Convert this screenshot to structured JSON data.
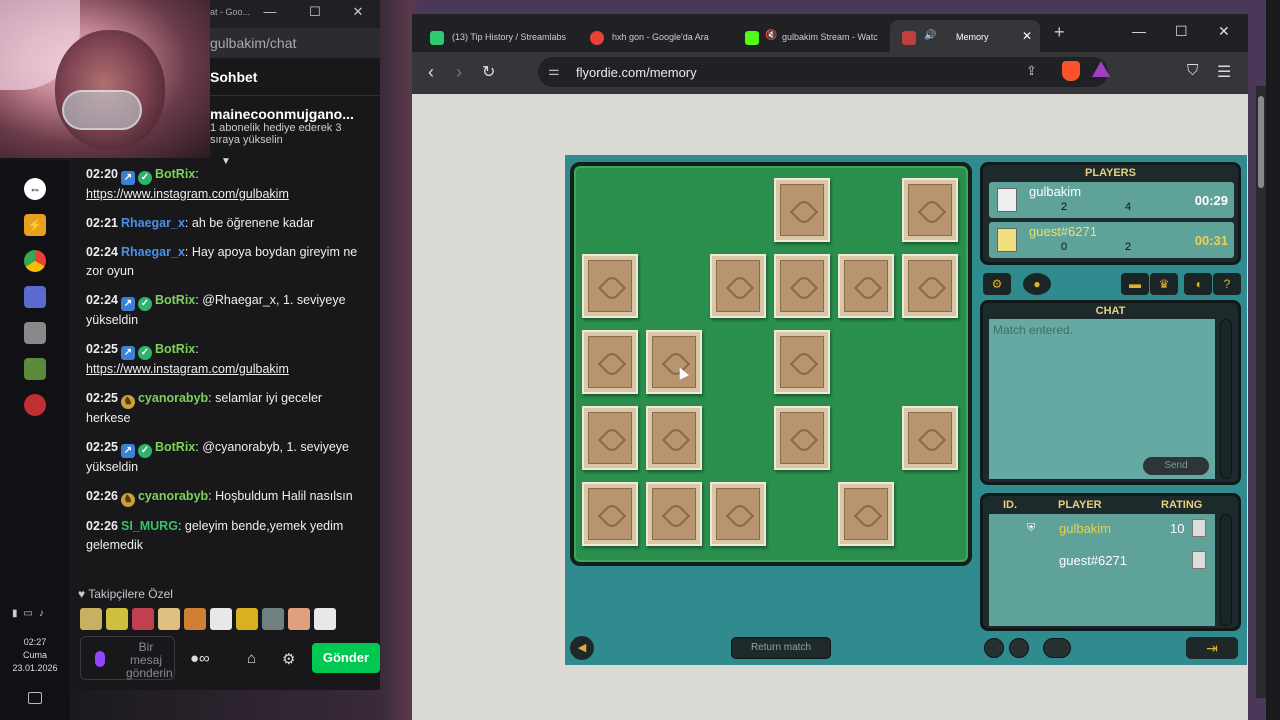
{
  "chat": {
    "window_title": "at - Goo...",
    "url": "gulbakim/chat",
    "header": "Sohbet",
    "pinned_user": "mainecoonmujgano...",
    "pinned_line1": "1 abonelik hediye ederek 3",
    "pinned_line2": "sıraya yükselin",
    "messages": [
      {
        "time": "02:20",
        "badges": [
          "pin",
          "chk"
        ],
        "name": "BotRix",
        "name_color": "#7bd35a",
        "text": "https://www.instagram.com/gulbakim",
        "link": true
      },
      {
        "time": "02:21",
        "badges": [],
        "name": "Rhaegar_x",
        "name_color": "#4f8fe6",
        "text": "ah be öğrenene kadar",
        "link": false
      },
      {
        "time": "02:24",
        "badges": [],
        "name": "Rhaegar_x",
        "name_color": "#4f8fe6",
        "text": "Hay apoya boydan gireyim ne zor oyun",
        "link": false
      },
      {
        "time": "02:24",
        "badges": [
          "pin",
          "chk"
        ],
        "name": "BotRix",
        "name_color": "#7bd35a",
        "text": "@Rhaegar_x, 1. seviyeye yükseldin",
        "link": false
      },
      {
        "time": "02:25",
        "badges": [
          "pin",
          "chk"
        ],
        "name": "BotRix",
        "name_color": "#7bd35a",
        "text": "https://www.instagram.com/gulbakim",
        "link": true
      },
      {
        "time": "02:25",
        "badges": [
          "cat"
        ],
        "name": "cyanorabyb",
        "name_color": "#7bd35a",
        "text": "selamlar iyi geceler herkese",
        "link": false
      },
      {
        "time": "02:25",
        "badges": [
          "pin",
          "chk"
        ],
        "name": "BotRix",
        "name_color": "#7bd35a",
        "text": "@cyanorabyb, 1. seviyeye yükseldin",
        "link": false
      },
      {
        "time": "02:26",
        "badges": [
          "cat"
        ],
        "name": "cyanorabyb",
        "name_color": "#7bd35a",
        "text": "Hoşbuldum Halil nasılsın",
        "link": false
      },
      {
        "time": "02:26",
        "badges": [],
        "name": "SI_MURG",
        "name_color": "#3bbf6a",
        "text": "geleyim bende,yemek yedim gelemedik",
        "link": false
      }
    ],
    "emote_label": "Takipçilere Özel",
    "input_placeholder": "Bir mesaj gönderin",
    "send_label": "Gönder"
  },
  "taskbar": {
    "time": "02:27",
    "day": "Cuma",
    "date": "23.01.2026"
  },
  "browser": {
    "tabs": [
      {
        "label": "(13) Tip History / Streamlabs",
        "fav_color": "#2ecc71"
      },
      {
        "label": "hxh gon - Google'da Ara",
        "fav_color": "#e94235"
      },
      {
        "label": "gulbakim Stream - Watc",
        "fav_color": "#53fc18"
      },
      {
        "label": "Memory",
        "fav_color": "#c04040"
      }
    ],
    "url": "flyordie.com/memory"
  },
  "game": {
    "players_title": "PLAYERS",
    "players": [
      {
        "name": "gulbakim",
        "score_a": "2",
        "score_b": "4",
        "time": "00:29",
        "name_color": "#ffffff",
        "time_color": "#ffffff"
      },
      {
        "name": "guest#6271",
        "score_a": "0",
        "score_b": "2",
        "time": "00:31",
        "name_color": "#f0e070",
        "time_color": "#f0d050"
      }
    ],
    "chat_title": "CHAT",
    "chat_text": "Match entered.",
    "chat_send": "Send",
    "rank_headers": {
      "id": "ID.",
      "player": "PLAYER",
      "rating": "RATING"
    },
    "rank_rows": [
      {
        "name": "gulbakim",
        "rating": "10",
        "color": "#e8d050"
      },
      {
        "name": "guest#6271",
        "rating": "",
        "color": "#ffffff"
      }
    ],
    "return_label": "Return match",
    "cards": [
      {
        "col": 3,
        "row": 0
      },
      {
        "col": 5,
        "row": 0
      },
      {
        "col": 0,
        "row": 1
      },
      {
        "col": 2,
        "row": 1
      },
      {
        "col": 3,
        "row": 1
      },
      {
        "col": 4,
        "row": 1
      },
      {
        "col": 5,
        "row": 1
      },
      {
        "col": 0,
        "row": 2
      },
      {
        "col": 1,
        "row": 2
      },
      {
        "col": 3,
        "row": 2
      },
      {
        "col": 0,
        "row": 3
      },
      {
        "col": 1,
        "row": 3
      },
      {
        "col": 3,
        "row": 3
      },
      {
        "col": 5,
        "row": 3
      },
      {
        "col": 0,
        "row": 4
      },
      {
        "col": 1,
        "row": 4
      },
      {
        "col": 2,
        "row": 4
      },
      {
        "col": 4,
        "row": 4
      }
    ]
  }
}
